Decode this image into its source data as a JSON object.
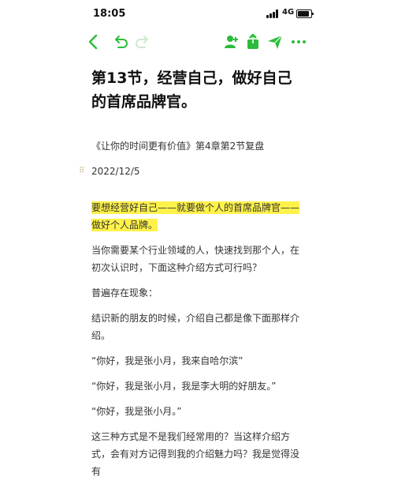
{
  "status_bar": {
    "time": "18:05",
    "network": "4G",
    "battery_level": 0.85
  },
  "toolbar": {
    "icons": [
      "back-icon",
      "undo-icon",
      "redo-icon",
      "share-person-icon",
      "export-icon",
      "send-icon",
      "more-icon"
    ],
    "accent_color": "#2bbd3a",
    "disabled_color": "#cfe9cf"
  },
  "note": {
    "title": "第13节，经营自己，做好自己的首席品牌官。",
    "source": "《让你的时间更有价值》第4章第2节复盘",
    "date": "2022/12/5",
    "highlight": "要想经营好自己——就要做个人的首席品牌官——做好个人品牌。",
    "paragraphs": [
      "当你需要某个行业领域的人，快速找到那个人，在初次认识时，下面这种介绍方式可行吗？",
      "普遍存在现象：",
      "结识新的朋友的时候，介绍自己都是像下面那样介绍。",
      "“你好，我是张小月，我来自哈尔滨”",
      "“你好，我是张小月，我是李大明的好朋友。”",
      "“你好，我是张小月。”",
      "这三种方式是不是我们经常用的？当这样介绍方式，会有对方记得到我的介绍魅力吗？我是觉得没有"
    ],
    "highlight_color": "#fff24a"
  }
}
